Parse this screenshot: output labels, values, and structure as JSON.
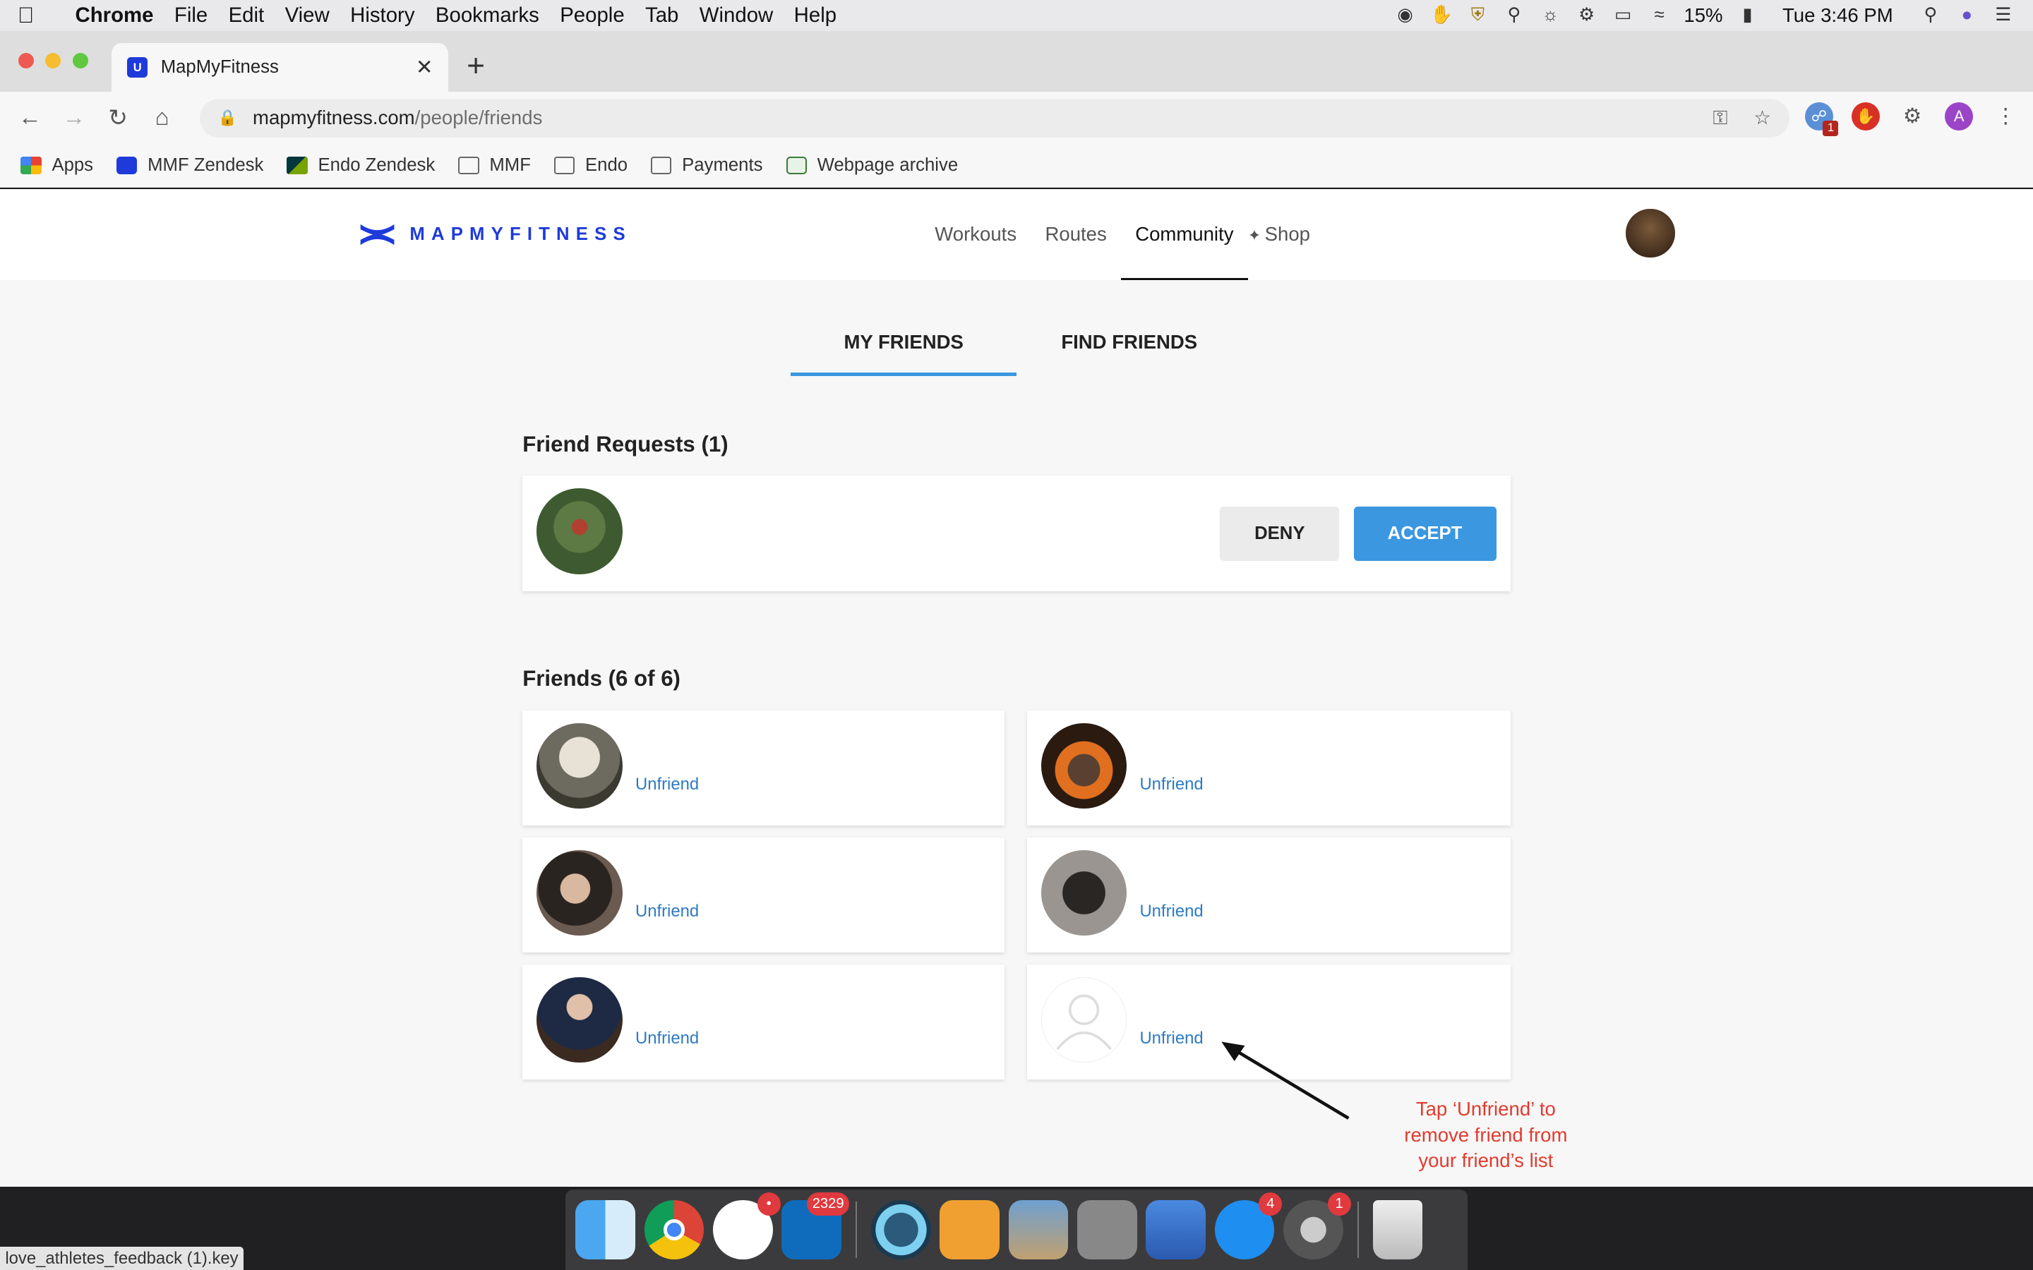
{
  "menubar": {
    "app": "Chrome",
    "items": [
      "File",
      "Edit",
      "View",
      "History",
      "Bookmarks",
      "People",
      "Tab",
      "Window",
      "Help"
    ],
    "battery": "15%",
    "clock": "Tue 3:46 PM"
  },
  "browser": {
    "tab_title": "MapMyFitness",
    "url_host": "mapmyfitness.com",
    "url_path": "/people/friends",
    "profile_initial": "A",
    "ext_badge": "1"
  },
  "bookmarks": [
    "Apps",
    "MMF Zendesk",
    "Endo Zendesk",
    "MMF",
    "Endo",
    "Payments",
    "Webpage archive"
  ],
  "site": {
    "logo_text": "MAPMYFITNESS",
    "nav": [
      "Workouts",
      "Routes",
      "Community",
      "Shop"
    ]
  },
  "tabs": {
    "my_friends": "MY FRIENDS",
    "find_friends": "FIND FRIENDS"
  },
  "requests": {
    "title": "Friend Requests (1)",
    "deny": "DENY",
    "accept": "ACCEPT"
  },
  "friends": {
    "title": "Friends (6 of 6)",
    "unfriend_label": "Unfriend"
  },
  "annotation": "Tap ‘Unfriend’ to remove friend from your friend’s list",
  "dock": {
    "slack_badge": "•",
    "outlook_badge": "2329",
    "appstore_badge": "4",
    "prefs_badge": "1"
  },
  "statusbar": "love_athletes_feedback (1).key"
}
